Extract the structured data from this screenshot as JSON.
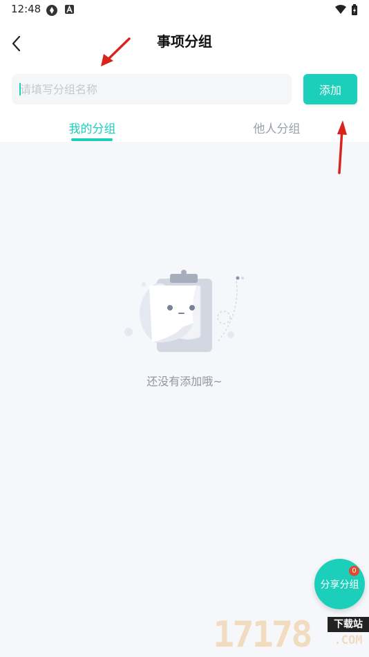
{
  "status_bar": {
    "time": "12:48"
  },
  "header": {
    "title": "事项分组"
  },
  "group_input": {
    "placeholder": "请填写分组名称",
    "value": ""
  },
  "add_button": {
    "label": "添加"
  },
  "tabs": [
    {
      "label": "我的分组",
      "active": true
    },
    {
      "label": "他人分组",
      "active": false
    }
  ],
  "empty_state": {
    "text": "还没有添加哦~"
  },
  "share_button": {
    "label": "分享分组",
    "badge": "0"
  },
  "watermark": {
    "text": "17178",
    "sub": "下载站",
    "domain": ".COM"
  },
  "colors": {
    "accent": "#1ccfbb",
    "badge": "#e04a2f",
    "annotation": "#d9231d"
  }
}
